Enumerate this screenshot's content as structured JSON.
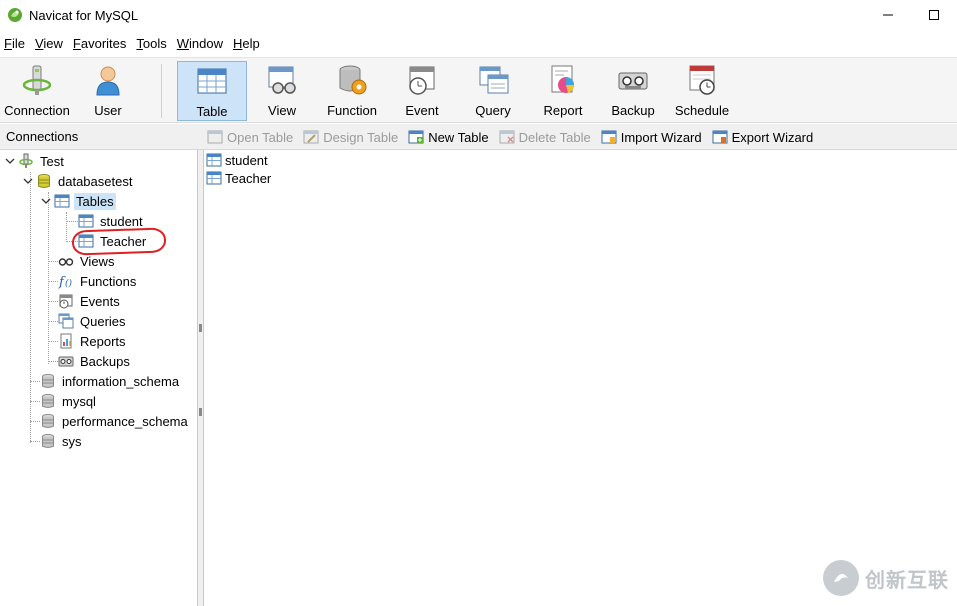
{
  "window": {
    "title": "Navicat for MySQL",
    "minimize_icon": "minimize-icon",
    "maximize_icon": "maximize-icon"
  },
  "menu": [
    {
      "underline": "F",
      "rest": "ile"
    },
    {
      "underline": "V",
      "rest": "iew"
    },
    {
      "underline": "F",
      "rest": "avorites"
    },
    {
      "underline": "T",
      "rest": "ools"
    },
    {
      "underline": "W",
      "rest": "indow"
    },
    {
      "underline": "H",
      "rest": "elp"
    }
  ],
  "toolbar": {
    "connection": "Connection",
    "user": "User",
    "table": "Table",
    "view": "View",
    "function": "Function",
    "event": "Event",
    "query": "Query",
    "report": "Report",
    "backup": "Backup",
    "schedule": "Schedule",
    "active": "Table"
  },
  "strip": {
    "connections_label": "Connections",
    "open_table": "Open Table",
    "design_table": "Design Table",
    "new_table": "New Table",
    "delete_table": "Delete Table",
    "import_wizard": "Import Wizard",
    "export_wizard": "Export Wizard"
  },
  "tree": {
    "connection": "Test",
    "database": "databasetest",
    "tables": "Tables",
    "table_1": "student",
    "table_2": "Teacher",
    "views": "Views",
    "functions": "Functions",
    "events": "Events",
    "queries": "Queries",
    "reports": "Reports",
    "backups": "Backups",
    "db_2": "information_schema",
    "db_3": "mysql",
    "db_4": "performance_schema",
    "db_5": "sys"
  },
  "content": {
    "items": [
      "student",
      "Teacher"
    ]
  },
  "watermark": {
    "text": "创新互联"
  },
  "colors": {
    "selection": "#cce4f7",
    "active_tool": "#cde3f7",
    "annotation": "#e02020"
  }
}
